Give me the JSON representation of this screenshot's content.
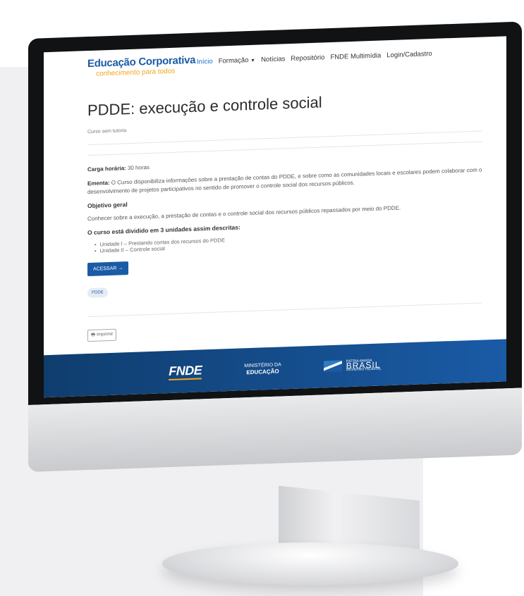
{
  "nav": {
    "logo_title": "Educação Corporativa",
    "logo_subtitle": "conhecimento para todos",
    "items": [
      {
        "label": "Início",
        "active": true
      },
      {
        "label": "Formação",
        "dropdown": true
      },
      {
        "label": "Notícias"
      },
      {
        "label": "Repositório"
      },
      {
        "label": "FNDE Multimídia"
      },
      {
        "label": "Login/Cadastro"
      }
    ]
  },
  "page": {
    "title": "PDDE: execução e controle social",
    "subtitle": "Curso sem tutoria",
    "carga_label": "Carga horária:",
    "carga_value": "30 horas",
    "ementa_label": "Ementa:",
    "ementa_text": "O Curso disponibiliza informações sobre a prestação de contas do PDDE, e sobre como as comunidades locais e escolares podem colaborar com o desenvolvimento de projetos participativos no sentido de promover o controle social dos recursos públicos.",
    "objetivo_heading": "Objetivo geral",
    "objetivo_text": "Conhecer sobre a execução, a prestação de contas e o controle social dos recursos públicos repassados por meio do PDDE.",
    "units_heading": "O curso está dividido em 3 unidades assim descritas:",
    "units": [
      "Unidade I – Prestando contas dos recursos do PDDE",
      "Unidade II – Controle social"
    ],
    "access_button": "ACESSAR →",
    "tag": "PDDE",
    "print_button": "Imprimir"
  },
  "footer": {
    "fnde": "FNDE",
    "mec_line1": "MINISTÉRIO DA",
    "mec_line2": "EDUCAÇÃO",
    "brasil_small": "PÁTRIA AMADA",
    "brasil_big": "BRASIL",
    "brasil_sub": "GOVERNO FEDERAL"
  },
  "colors": {
    "brand_blue": "#1a5ba6",
    "brand_orange": "#f2a51a",
    "bezel": "#111214"
  }
}
